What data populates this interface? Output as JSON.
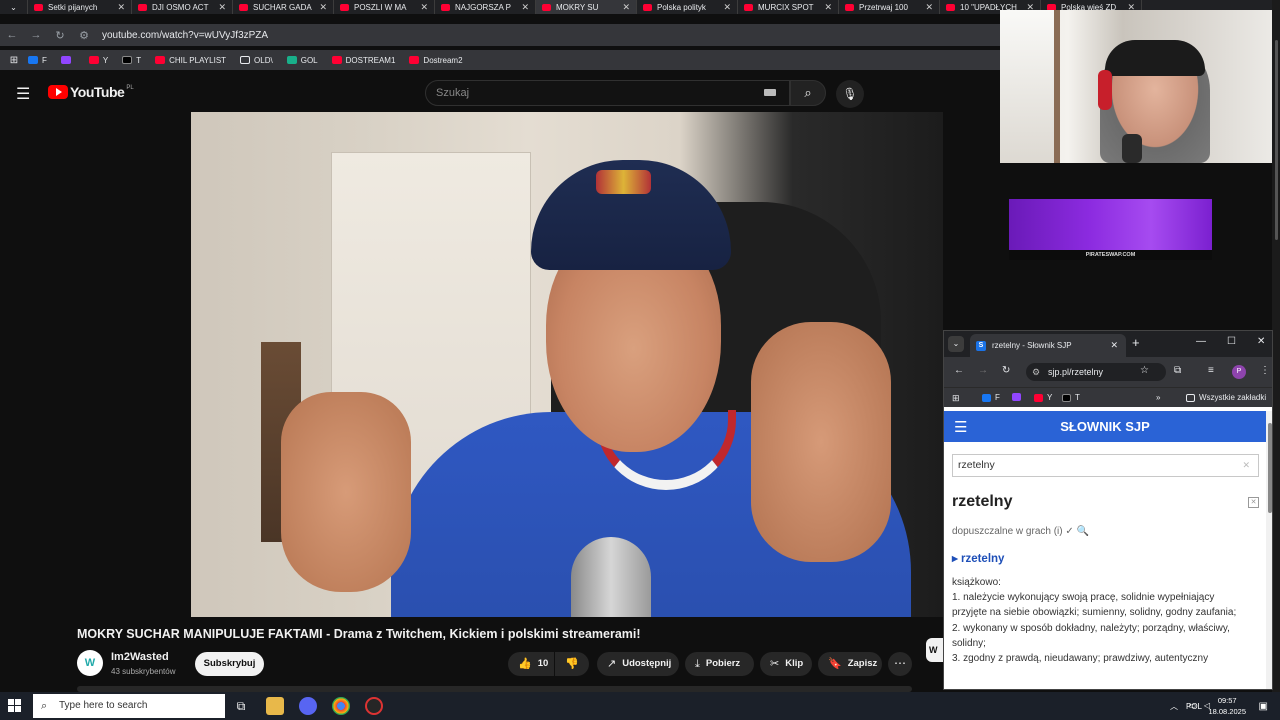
{
  "browser": {
    "tabs": [
      {
        "label": "Setki pijanych",
        "active": false
      },
      {
        "label": "DJI OSMO ACT",
        "active": false
      },
      {
        "label": "SUCHAR GADA",
        "active": false
      },
      {
        "label": "POSZLI W MA",
        "active": false
      },
      {
        "label": "NAJGORSZA P",
        "active": false
      },
      {
        "label": "MOKRY SU",
        "active": true
      },
      {
        "label": "Polska polityk",
        "active": false
      },
      {
        "label": "MURCIX SPOT",
        "active": false
      },
      {
        "label": "Przetrwaj 100",
        "active": false
      },
      {
        "label": "10 \"UPADŁYCH",
        "active": false
      },
      {
        "label": "Polska wieś ZD",
        "active": false
      }
    ],
    "url": "youtube.com/watch?v=wUVyJf3zPZA",
    "bookmarks": [
      "F",
      "",
      "Y",
      "T",
      "CHIL PLAYLIST",
      "OLD\\",
      "GOL",
      "DOSTREAM1",
      "Dostream2"
    ]
  },
  "youtube": {
    "logo_text": "YouTube",
    "country_code": "PL",
    "search_placeholder": "Szukaj",
    "video_title": "MOKRY SUCHAR MANIPULUJE FAKTAMI - Drama z Twitchem, Kickiem i polskimi streamerami!",
    "channel_name": "Im2Wasted",
    "channel_subs": "43 subskrybentów",
    "subscribe_label": "Subskrybuj",
    "like_count": "10",
    "share_label": "Udostępnij",
    "download_label": "Pobierz",
    "clip_label": "Klip",
    "save_label": "Zapisz",
    "side_stub": "W"
  },
  "ad": {
    "label": "PIRATESWAP.COM"
  },
  "sjp_popup": {
    "tab_title": "rzetelny - Słownik SJP",
    "url": "sjp.pl/rzetelny",
    "bookmarks": [
      "F",
      "",
      "Y",
      "T"
    ],
    "all_bookmarks": "Wszystkie zakładki",
    "header_title": "SŁOWNIK SJP",
    "search_value": "rzetelny",
    "word": "rzetelny",
    "games_note": "dopuszczalne w grach (i) ✓ 🔍",
    "entry": "rzetelny",
    "definition_lines": [
      "książkowo:",
      "1. należycie wykonujący swoją pracę, solidnie wypełniający",
      "przyjęte na siebie obowiązki; sumienny, solidny, godny zaufania;",
      "2. wykonany w sposób dokładny, należyty; porządny, właściwy,",
      "solidny;",
      "3. zgodny z prawdą, nieudawany; prawdziwy, autentyczny"
    ],
    "avatar_letter": "P"
  },
  "taskbar": {
    "search_placeholder": "Type here to search",
    "language": "POL",
    "time": "09:57",
    "date": "18.08.2025"
  },
  "colors": {
    "yt_red": "#ff0000",
    "sjp_blue": "#2a63d6",
    "link_blue": "#1e4fb8",
    "ad_purple": "#8c2be0"
  }
}
